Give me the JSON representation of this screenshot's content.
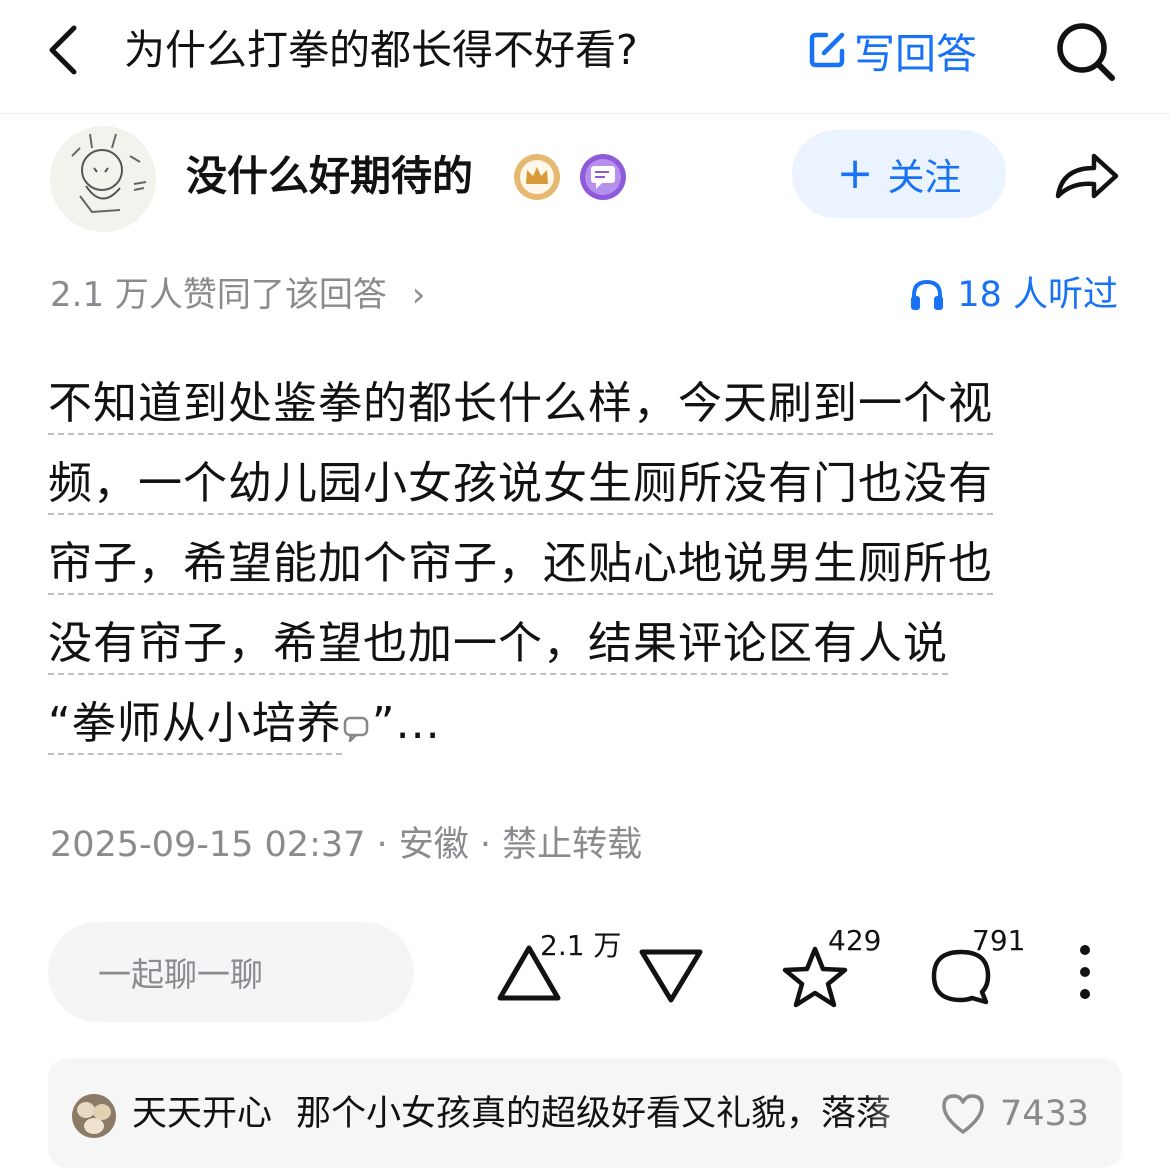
{
  "header": {
    "question_title": "为什么打拳的都长得不好看?",
    "write_answer_label": "写回答",
    "icons": {
      "back": "chevron-left-icon",
      "write": "edit-icon",
      "search": "search-icon"
    }
  },
  "author": {
    "name": "没什么好期待的",
    "follow_label": "关注",
    "follow_plus": "+",
    "badges": [
      "crown-badge-icon",
      "chat-badge-icon"
    ]
  },
  "stats": {
    "agree_text": "2.1 万人赞同了该回答",
    "agree_chevron": "›",
    "listen_text": "18 人听过"
  },
  "content": {
    "lines": [
      "不知道到处鉴拳的都长什么样，今天刷到一个视",
      "频，一个幼儿园小女孩说女生厕所没有门也没有",
      "帘子，希望能加个帘子，还贴心地说男生厕所也",
      "没有帘子，希望也加一个，结果评论区有人说",
      "“拳师从小培养"
    ],
    "tail": "”..."
  },
  "meta": {
    "text": "2025-09-15 02:37 · 安徽 · 禁止转载"
  },
  "actions": {
    "chat_placeholder": "一起聊一聊",
    "upvote_count": "2.1 万",
    "favorite_count": "429",
    "comment_count": "791"
  },
  "hot_comment": {
    "user": "天天开心",
    "text": "那个小女孩真的超级好看又礼貌，落落",
    "like_count": "7433"
  },
  "colors": {
    "accent": "#1772f6",
    "follow_bg": "#ebf4fe",
    "muted_text": "#8a8a8f",
    "pill_bg": "#f5f5f7"
  }
}
